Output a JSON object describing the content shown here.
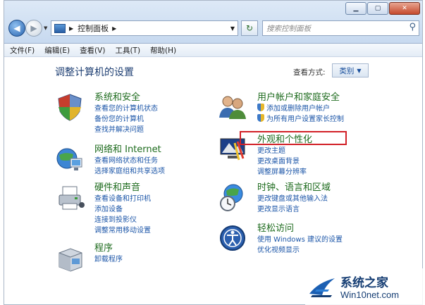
{
  "address_bar": {
    "crumb": "控制面板"
  },
  "search": {
    "placeholder": "搜索控制面板"
  },
  "menu": [
    "文件(F)",
    "编辑(E)",
    "查看(V)",
    "工具(T)",
    "帮助(H)"
  ],
  "page": {
    "title": "调整计算机的设置",
    "view_by_label": "查看方式:",
    "view_by_value": "类别"
  },
  "categories_left": [
    {
      "title": "系统和安全",
      "links": [
        "查看您的计算机状态",
        "备份您的计算机",
        "查找并解决问题"
      ]
    },
    {
      "title": "网络和 Internet",
      "links": [
        "查看网络状态和任务",
        "选择家庭组和共享选项"
      ]
    },
    {
      "title": "硬件和声音",
      "links": [
        "查看设备和打印机",
        "添加设备",
        "连接到投影仪",
        "调整常用移动设置"
      ]
    },
    {
      "title": "程序",
      "links": [
        "卸载程序"
      ]
    }
  ],
  "categories_right": [
    {
      "title": "用户帐户和家庭安全",
      "links": [
        "添加或删除用户帐户",
        "为所有用户设置家长控制"
      ]
    },
    {
      "title": "外观和个性化",
      "links": [
        "更改主题",
        "更改桌面背景",
        "调整屏幕分辨率"
      ]
    },
    {
      "title": "时钟、语言和区域",
      "links": [
        "更改键盘或其他输入法",
        "更改显示语言"
      ]
    },
    {
      "title": "轻松访问",
      "links": [
        "使用 Windows 建议的设置",
        "优化视频显示"
      ]
    }
  ],
  "watermark": {
    "name": "系统之家",
    "url": "Win10net.com"
  },
  "colors": {
    "category_title": "#1d6b1d",
    "link": "#1c56a8",
    "highlight_border": "#d22027",
    "title": "#1e3f73"
  }
}
